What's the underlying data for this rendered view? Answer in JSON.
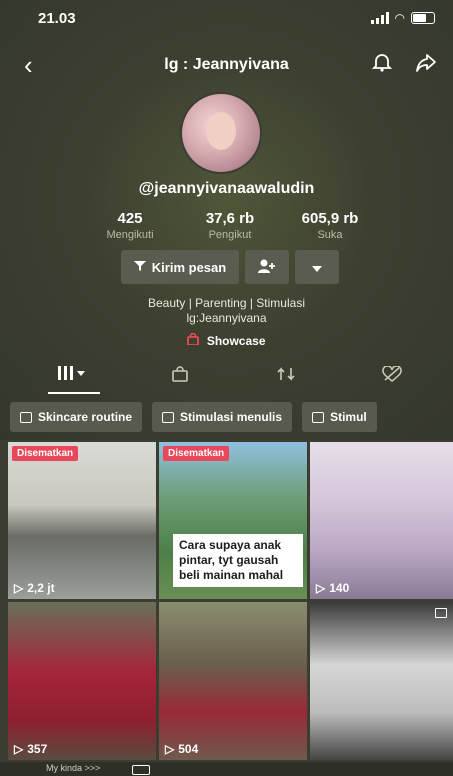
{
  "status_bar": {
    "time": "21.03"
  },
  "header": {
    "title": "lg : Jeannyivana"
  },
  "profile": {
    "handle": "@jeannyivanaawaludin",
    "stats": [
      {
        "value": "425",
        "label": "Mengikuti"
      },
      {
        "value": "37,6 rb",
        "label": "Pengikut"
      },
      {
        "value": "605,9 rb",
        "label": "Suka"
      }
    ],
    "message_button": "Kirim pesan",
    "bio_line1": "Beauty | Parenting | Stimulasi",
    "bio_line2": "lg:Jeannyivana",
    "showcase": "Showcase"
  },
  "playlists": [
    "Skincare routine",
    "Stimulasi menulis",
    "Stimul"
  ],
  "videos": [
    {
      "badge": "Disematkan",
      "views": "2,2 jt",
      "caption": ""
    },
    {
      "badge": "Disematkan",
      "views": "",
      "caption": "Cara supaya anak pintar, tyt gausah beli mainan mahal"
    },
    {
      "badge": "",
      "views": "140",
      "caption": ""
    },
    {
      "badge": "",
      "views": "357",
      "caption": ""
    },
    {
      "badge": "",
      "views": "504",
      "caption": ""
    },
    {
      "badge": "",
      "views": "",
      "caption": ""
    }
  ],
  "bottom_bar": {
    "text": "My kinda >>>"
  },
  "colors": {
    "background": "#3b3d31",
    "pinned_badge": "#e8485a",
    "button": "#5a5c4f"
  }
}
